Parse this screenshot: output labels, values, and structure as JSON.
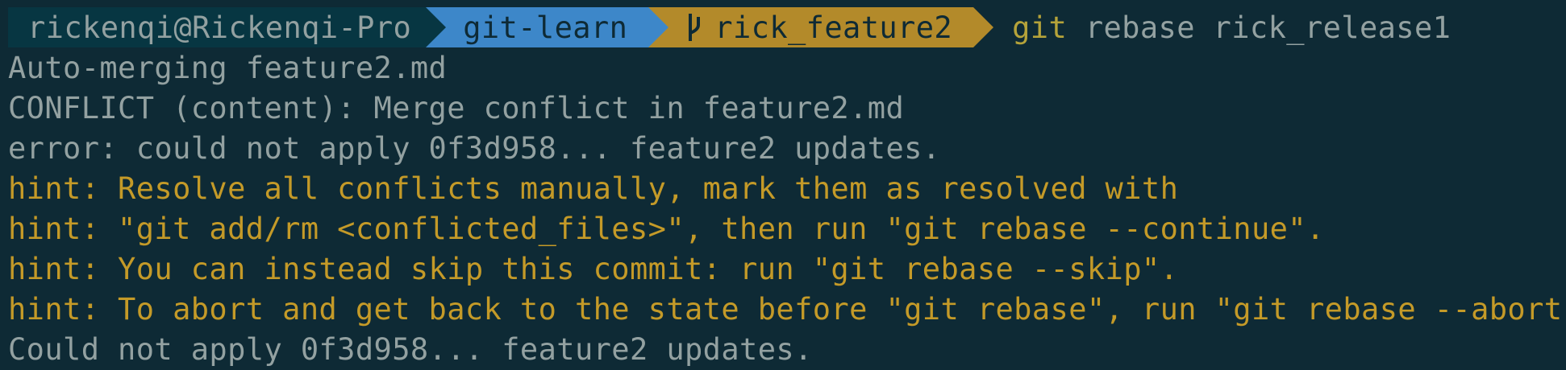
{
  "prompt": {
    "user_host": "rickenqi@Rickenqi-Pro",
    "directory": "git-learn",
    "branch": "rick_feature2",
    "command_program": "git",
    "command_args": "rebase rick_release1"
  },
  "output_lines": [
    {
      "kind": "normal",
      "text": "Auto-merging feature2.md"
    },
    {
      "kind": "normal",
      "text": "CONFLICT (content): Merge conflict in feature2.md"
    },
    {
      "kind": "normal",
      "text": "error: could not apply 0f3d958... feature2 updates."
    },
    {
      "kind": "hint",
      "text": "hint: Resolve all conflicts manually, mark them as resolved with"
    },
    {
      "kind": "hint",
      "text": "hint: \"git add/rm <conflicted_files>\", then run \"git rebase --continue\"."
    },
    {
      "kind": "hint",
      "text": "hint: You can instead skip this commit: run \"git rebase --skip\"."
    },
    {
      "kind": "hint",
      "text": "hint: To abort and get back to the state before \"git rebase\", run \"git rebase --abort\"."
    },
    {
      "kind": "normal",
      "text": "Could not apply 0f3d958... feature2 updates."
    }
  ],
  "icons": {
    "branch": "git-branch-icon"
  },
  "colors": {
    "background": "#0e2a35",
    "user_segment": "#073642",
    "directory_segment": "#3d87c9",
    "branch_segment": "#b38a2a",
    "hint_text": "#c49a28",
    "normal_text": "#93a1a1"
  }
}
